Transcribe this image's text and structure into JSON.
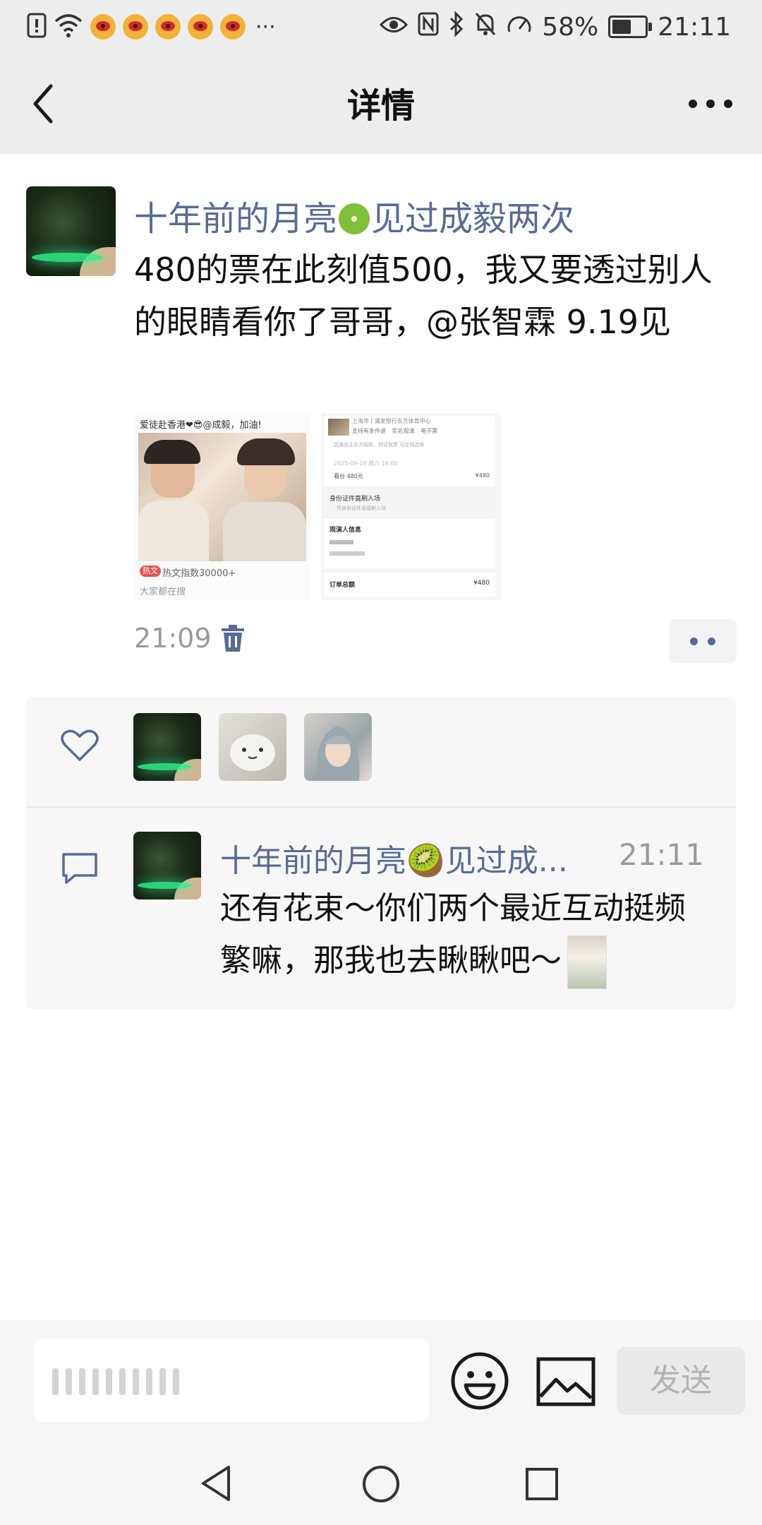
{
  "status": {
    "battery": "58%",
    "battery_level": 0.58,
    "time": "21:11",
    "notification_count_icons": 5,
    "overflow": "···"
  },
  "nav": {
    "title": "详情"
  },
  "post": {
    "username_part1": "十年前的月亮",
    "username_part2": "见过成毅两次",
    "text": "480的票在此刻值500，我又要透过别人的眼睛看你了哥哥，@张智霖 9.19见",
    "time": "21:09",
    "image1": {
      "caption": "爱徒赴香港❤😎@成毅，加油!",
      "badge": "热文",
      "hot": "热文指数30000+",
      "footer": "大家都在搜"
    },
    "image2": {
      "venue": "上海市 | 浦发银行东方体育中心",
      "tags": [
        "支持有条件退",
        "实名观演",
        "电子票"
      ],
      "notice": "因演出主办方规则，持证取票 可在线选座",
      "date": "2025-09-19 周六 19:00",
      "ticket_label": "看台 480元",
      "ticket_price": "¥480",
      "entry": "身份证件直刷入场",
      "entry_sub": "凭身份证件直接刷入场",
      "viewer": "观演人信息",
      "total_label": "订单总额",
      "total": "¥480"
    }
  },
  "likes": {
    "avatars": [
      "night-avatar",
      "cat-avatar",
      "girl-avatar"
    ]
  },
  "comment": {
    "username": "十年前的月亮🥝见过成...",
    "time": "21:11",
    "text": "还有花束～你们两个最近互动挺频繁嘛，那我也去瞅瞅吧～"
  },
  "inputbar": {
    "send": "发送"
  },
  "colors": {
    "link": "#576b95",
    "topbar": "#ededed",
    "panel": "#f7f7f7"
  }
}
